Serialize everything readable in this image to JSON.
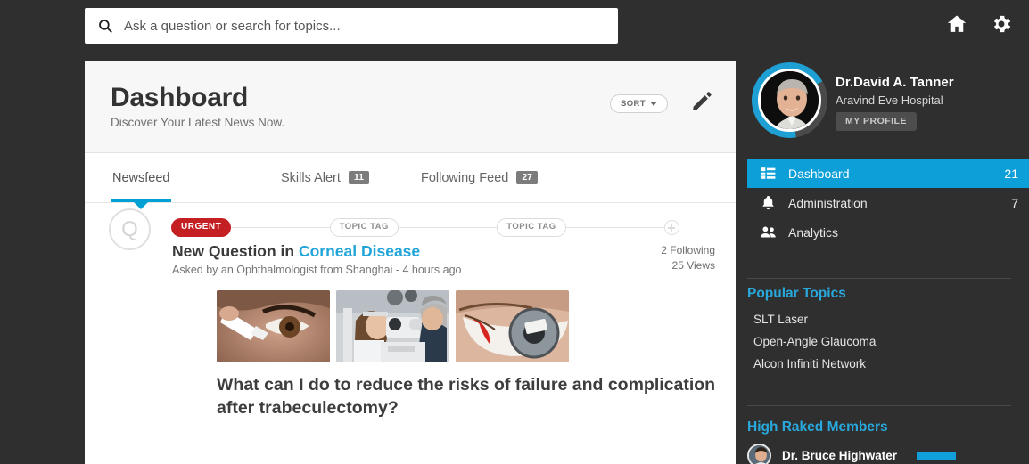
{
  "search": {
    "placeholder": "Ask a question or search for topics...",
    "value": "",
    "icon": "search-icon"
  },
  "topbar": {
    "home_icon": "home-icon",
    "settings_icon": "gear-icon"
  },
  "header": {
    "title": "Dashboard",
    "subtitle": "Discover Your Latest News Now.",
    "sort_label": "SORT",
    "sort_icon": "chevron-down-icon",
    "edit_icon": "pencil-icon"
  },
  "tabs": [
    {
      "label": "Newsfeed",
      "badge": "",
      "active": true
    },
    {
      "label": "Skills Alert",
      "badge": "11",
      "active": false
    },
    {
      "label": "Following Feed",
      "badge": "27",
      "active": false
    }
  ],
  "feed": {
    "avatar_letter": "Q",
    "tags": [
      {
        "label": "URGENT",
        "style": "urgent"
      },
      {
        "label": "TOPIC TAG",
        "style": "topic"
      },
      {
        "label": "TOPIC TAG",
        "style": "topic"
      }
    ],
    "add_icon": "plus-circle-icon",
    "title_prefix": "New Question in ",
    "title_link": "Corneal Disease",
    "meta": "Asked by an Ophthalmologist from Shanghai - 4 hours ago",
    "following": "2 Following",
    "views": "25 Views",
    "thumbnails": [
      {
        "name": "eye-drops-photo"
      },
      {
        "name": "slit-lamp-exam-photo"
      },
      {
        "name": "red-eye-closeup-photo"
      }
    ],
    "headline": "What can I do to reduce the risks of failure and complication after trabeculectomy?"
  },
  "profile": {
    "name": "Dr.David A. Tanner",
    "organization": "Aravind Eve Hospital",
    "button_label": "MY PROFILE"
  },
  "nav": [
    {
      "label": "Dashboard",
      "count": "21",
      "icon": "list-icon",
      "active": true
    },
    {
      "label": "Administration",
      "count": "7",
      "icon": "bell-icon",
      "active": false
    },
    {
      "label": "Analytics",
      "count": "",
      "icon": "people-icon",
      "active": false
    }
  ],
  "popular_topics": {
    "title": "Popular Topics",
    "items": [
      "SLT Laser",
      "Open-Angle Glaucoma",
      "Alcon Infiniti Network"
    ]
  },
  "high_ranked": {
    "title": "High Raked Members",
    "members": [
      {
        "name": "Dr. Bruce Highwater"
      }
    ]
  },
  "colors": {
    "accent": "#0d9fd8",
    "urgent": "#c41f22",
    "background": "#2f2f2f",
    "panel": "#ffffff"
  }
}
